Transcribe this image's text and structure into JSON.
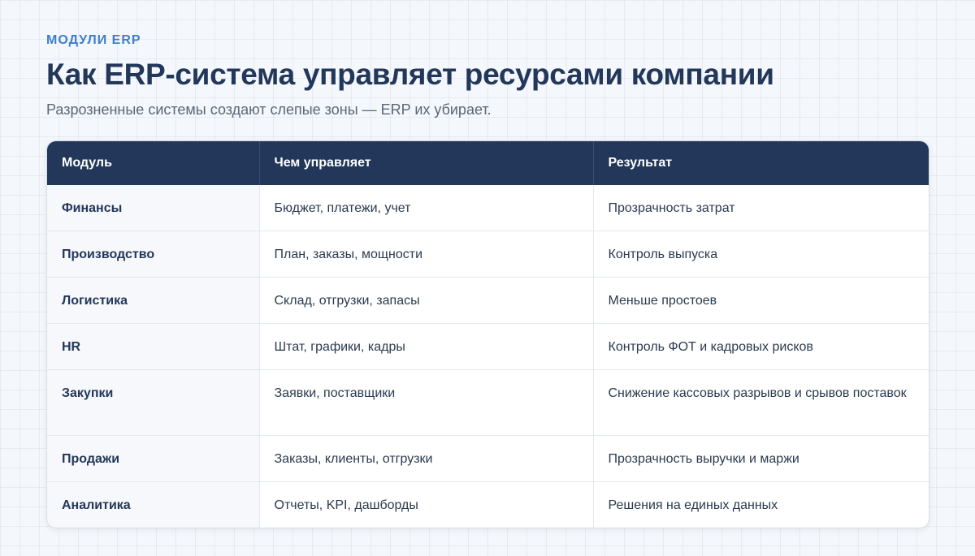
{
  "header": {
    "eyebrow": "МОДУЛИ ERP",
    "title": "Как ERP-система управляет ресурсами компании",
    "subtitle": "Разрозненные системы создают слепые зоны — ERP их убирает."
  },
  "table": {
    "columns": [
      "Модуль",
      "Чем управляет",
      "Результат"
    ],
    "rows": [
      [
        "Финансы",
        "Бюджет, платежи, учет",
        "Прозрачность затрат"
      ],
      [
        "Производство",
        "План, заказы, мощности",
        "Контроль выпуска"
      ],
      [
        "Логистика",
        "Склад, отгрузки, запасы",
        "Меньше простоев"
      ],
      [
        "HR",
        "Штат, графики, кадры",
        "Контроль ФОТ и кадровых рисков"
      ],
      [
        "Закупки",
        "Заявки, поставщики",
        "Снижение кассовых разрывов и срывов поставок"
      ],
      [
        "Продажи",
        "Заказы, клиенты, отгрузки",
        "Прозрачность выручки и маржи"
      ],
      [
        "Аналитика",
        "Отчеты, KPI, дашборды",
        "Решения на единых данных"
      ]
    ]
  },
  "colors": {
    "accent": "#3a7fd0",
    "header_bg": "#22375a",
    "title": "#22375a"
  }
}
